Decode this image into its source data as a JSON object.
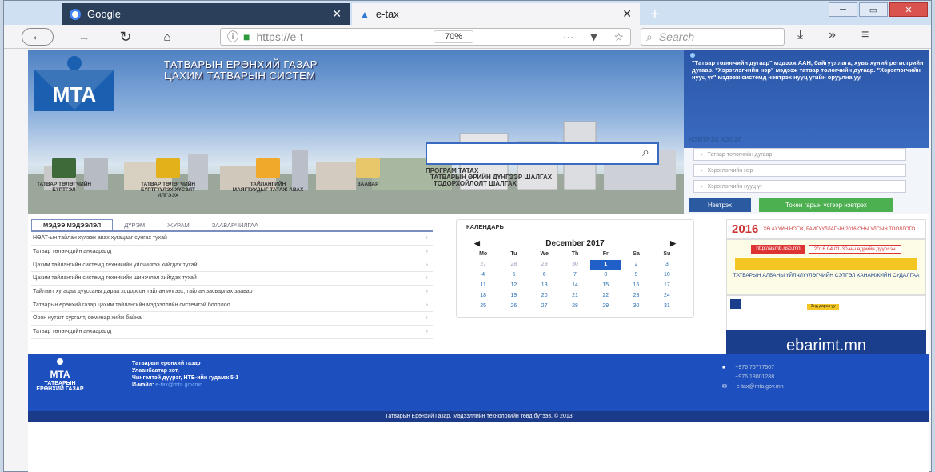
{
  "browser": {
    "tabs": [
      {
        "title": "Google",
        "close": "✕"
      },
      {
        "title": "e-tax",
        "close": "✕"
      }
    ],
    "new_tab": "+",
    "address": "https://e-t",
    "zoom": "70%",
    "search_placeholder": "Search",
    "more": "···",
    "pocket": "▼",
    "star": "☆",
    "tools": [
      "⤓",
      "»",
      "≡"
    ]
  },
  "header": {
    "title_line1": "ТАТВАРЫН ЕРӨНХИЙ ГАЗАР",
    "title_line2": "ЦАХИМ ТАТВАРЫН СИСТЕМ",
    "notice": "\"Татвар төлөгчийн дугаар\" мэдээж ААН, байгууллага, хувь хүний регистрийн дугаар. \"Хэрэглэгчийн нэр\" мэдээж татвар төлөгчийн дугаар. \"Хэрэглэгчийн нууц үг\" мэдээж системд нэвтрэх нууц үгийн оруулна уу.",
    "search_icon": "⌕"
  },
  "quick_icons": [
    {
      "label": "ТАТВАР ТӨЛӨГЧИЙН БҮРТГЭЛ",
      "color": "#3e6a3a"
    },
    {
      "label": "ТАТВАР ТӨЛӨГЧИЙН БҮРТГҮҮЛЭХ ХҮСЭЛТ ИЛГЭЭХ",
      "color": "#e3b21a"
    },
    {
      "label": "ТАЙЛАНГИЙН МАЯГТУУДЫГ ТАТАЖ АВАХ",
      "color": "#f0a92a"
    },
    {
      "label": "ЗААВАР",
      "color": "#e8c66a"
    }
  ],
  "quick_links": [
    "ПРОГРАМ ТАТАХ",
    "ТАТВАРЫН ӨРИЙН ДҮНГЭЭР ШАЛГАХ",
    "ТОДОРХОЙЛОЛТ ШАЛГАХ"
  ],
  "login": {
    "title": "НЭВТРЭХ ХЭСЭГ",
    "taxpayer_no_placeholder": "Татвар төлөгчийн дугаар",
    "username_placeholder": "Хэрэглэгчийн нэр",
    "password_placeholder": "Хэрэглэгчийн нууц үг",
    "login_button": "Нэвтрэх",
    "token_button": "Токен гарын үсгээр нэвтрэх"
  },
  "news": {
    "tabs": [
      "МЭДЭЭ МЭДЭЭЛЭЛ",
      "ДҮРЭМ",
      "ЖУРАМ",
      "ЗААВАРЧИЛГАА"
    ],
    "items": [
      "НӨАТ-ын тайлан хүлээн авах хугацааг сунгах тухай",
      "Татвар төлөгчдийн анхааралд",
      "Цахим тайлангийн системд техникийн үйлчилгээ хийгдах тухай",
      "Цахим тайлангийн системд техникийн шинэчлэл хийгдэх тухай",
      "Тайлант хугацаа дууссаны дараа хоцорсон тайлан илгээх, тайлан засварлах заавар",
      "Татварын ерөнхий газар цахим тайлангийн мэдээллийн системтэй болллоо",
      "Орон нутагт сургалт, семинар хийж байна",
      "Татвар төлөгчдийн анхааралд"
    ],
    "arrow": "›"
  },
  "calendar": {
    "title": "КАЛЕНДАРЬ",
    "month_label": "December 2017",
    "prev": "◀",
    "next": "▶",
    "day_headers": [
      "Mo",
      "Tu",
      "We",
      "Th",
      "Fr",
      "Sa",
      "Su"
    ],
    "days": [
      [
        "27",
        "m"
      ],
      [
        "28",
        "m"
      ],
      [
        "29",
        "m"
      ],
      [
        "30",
        "m"
      ],
      [
        "1",
        "s"
      ],
      [
        "2",
        ""
      ],
      [
        "3",
        ""
      ],
      [
        "4",
        ""
      ],
      [
        "5",
        ""
      ],
      [
        "6",
        ""
      ],
      [
        "7",
        ""
      ],
      [
        "8",
        ""
      ],
      [
        "9",
        ""
      ],
      [
        "10",
        ""
      ],
      [
        "11",
        ""
      ],
      [
        "12",
        ""
      ],
      [
        "13",
        ""
      ],
      [
        "14",
        ""
      ],
      [
        "15",
        ""
      ],
      [
        "16",
        ""
      ],
      [
        "17",
        ""
      ],
      [
        "18",
        ""
      ],
      [
        "19",
        ""
      ],
      [
        "20",
        ""
      ],
      [
        "21",
        ""
      ],
      [
        "22",
        ""
      ],
      [
        "23",
        ""
      ],
      [
        "24",
        ""
      ],
      [
        "25",
        ""
      ],
      [
        "26",
        ""
      ],
      [
        "27",
        ""
      ],
      [
        "28",
        ""
      ],
      [
        "29",
        ""
      ],
      [
        "30",
        ""
      ],
      [
        "31",
        ""
      ]
    ]
  },
  "ads": {
    "banner1_year": "2016",
    "banner1_text": "ХӨ АХУЙН НОГЖ, БАЙГУУЛЛАГЫН 2016 ОНЫ УЛСЫН ТООЛЛОГО",
    "banner2_url": "http://asmb.nso.mn",
    "banner2_dates": "2016.04.01-30-ны өдрийн дүүрсэн",
    "banner2_text": "ТАТВАРЫН АЛБАНЫ ҮЙЛЧЛҮҮЛЭГЧИЙН СЭТГЭЛ ХАНАМЖИЙН СУДАЛГАА",
    "banner3_button": "Энд дарна уу",
    "banner3_brand": "ebarimt.mn"
  },
  "footer": {
    "org_short": "ТАТВАРЫН ЕРӨНХИЙ ГАЗАР",
    "name": "Татварын ерөнхий газар",
    "city": "Улаанбаатар хот,",
    "address": "Чингэлтэй дүүрэг, НТБ-ийн гудамж 5-1",
    "email_label": "И-мэйл:",
    "email": "e-tax@mta.gov.mn",
    "phone1": "+976 75777507",
    "phone2": "+976 18001288",
    "email2": "e-tax@mta.gov.mn",
    "copyright": "Татварын Ерөнхий Газар, Мэдээллийн технологийн төвд бүтээв. © 2013"
  }
}
